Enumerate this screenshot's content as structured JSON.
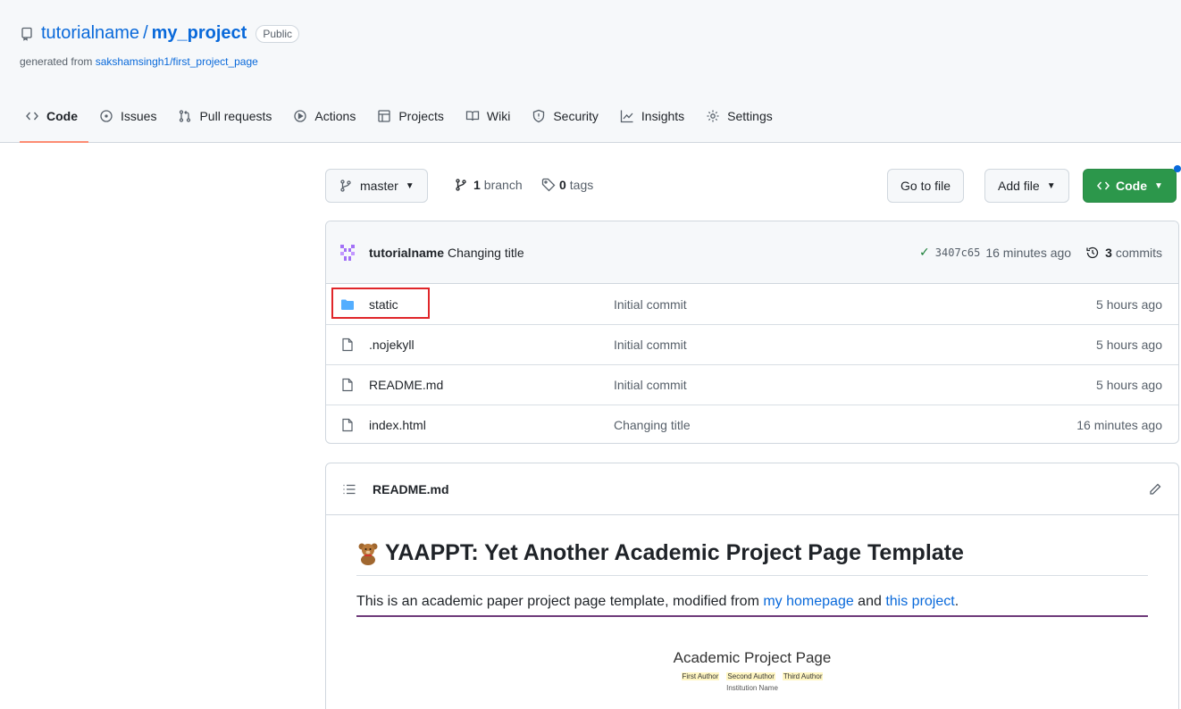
{
  "repo": {
    "owner": "tutorialname",
    "separator": "/",
    "name": "my_project",
    "visibility": "Public",
    "generated_prefix": "generated from ",
    "generated_from": "sakshamsingh1/first_project_page"
  },
  "nav": {
    "tabs": [
      {
        "label": "Code",
        "icon": "code-icon"
      },
      {
        "label": "Issues",
        "icon": "issue-icon"
      },
      {
        "label": "Pull requests",
        "icon": "pull-request-icon"
      },
      {
        "label": "Actions",
        "icon": "play-icon"
      },
      {
        "label": "Projects",
        "icon": "table-icon"
      },
      {
        "label": "Wiki",
        "icon": "book-icon"
      },
      {
        "label": "Security",
        "icon": "shield-icon"
      },
      {
        "label": "Insights",
        "icon": "graph-icon"
      },
      {
        "label": "Settings",
        "icon": "gear-icon"
      }
    ]
  },
  "toolbar": {
    "branch": "master",
    "branch_count": "1",
    "branch_label": "branch",
    "tag_count": "0",
    "tag_label": "tags",
    "goto_file": "Go to file",
    "add_file": "Add file",
    "code": "Code"
  },
  "commit": {
    "author": "tutorialname",
    "message": "Changing title",
    "sha": "3407c65",
    "age": "16 minutes ago",
    "commit_count": "3",
    "commit_label": "commits"
  },
  "files": [
    {
      "type": "folder",
      "name": "static",
      "message": "Initial commit",
      "age": "5 hours ago"
    },
    {
      "type": "file",
      "name": ".nojekyll",
      "message": "Initial commit",
      "age": "5 hours ago"
    },
    {
      "type": "file",
      "name": "README.md",
      "message": "Initial commit",
      "age": "5 hours ago"
    },
    {
      "type": "file",
      "name": "index.html",
      "message": "Changing title",
      "age": "16 minutes ago"
    }
  ],
  "readme": {
    "filename": "README.md",
    "heading": "YAAPPT: Yet Another Academic Project Page Template",
    "intro_text": "This is an academic paper project page template, modified from ",
    "link1": "my homepage",
    "and_text": " and ",
    "link2": "this project",
    "end_text": ".",
    "preview": {
      "title": "Academic Project Page",
      "authors": [
        "First Author",
        "Second Author",
        "Third Author"
      ],
      "institution": "Institution Name"
    }
  },
  "colors": {
    "accent": "#0969da",
    "selected_tab": "#fd8c73",
    "code_button": "#2c974b",
    "highlight": "#e0262a"
  }
}
